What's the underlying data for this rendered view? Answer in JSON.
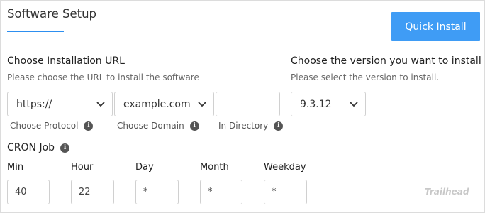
{
  "header": {
    "title": "Software Setup",
    "quick_install_label": "Quick Install"
  },
  "installation_url": {
    "heading": "Choose Installation URL",
    "subheading": "Please choose the URL to install the software",
    "protocol": {
      "value": "https://",
      "caption": "Choose Protocol"
    },
    "domain": {
      "value": "example.com",
      "caption": "Choose Domain"
    },
    "directory": {
      "value": "",
      "caption": "In Directory"
    }
  },
  "version": {
    "heading": "Choose the version you want to install",
    "subheading": "Please select the version to install.",
    "selected": "9.3.12"
  },
  "cron": {
    "heading": "CRON Job",
    "fields": [
      {
        "label": "Min",
        "value": "40"
      },
      {
        "label": "Hour",
        "value": "22"
      },
      {
        "label": "Day",
        "value": "*"
      },
      {
        "label": "Month",
        "value": "*"
      },
      {
        "label": "Weekday",
        "value": "*"
      }
    ]
  },
  "watermark": "Trailhead",
  "colors": {
    "accent": "#3f9cf5",
    "underline": "#2d8ff0"
  }
}
